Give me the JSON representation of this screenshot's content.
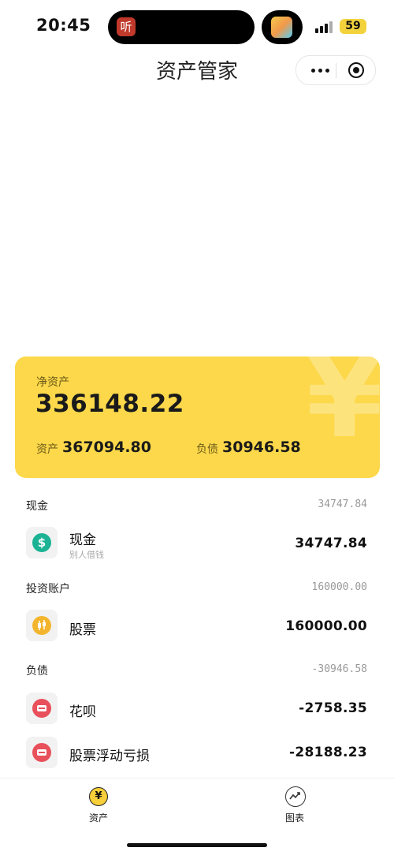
{
  "status_bar": {
    "time": "20:45",
    "battery": "59",
    "island_app_glyph": "听"
  },
  "nav": {
    "title": "资产管家"
  },
  "summary": {
    "net_assets_label": "净资产",
    "net_assets_value": "336148.22",
    "assets_label": "资产",
    "assets_value": "367094.80",
    "liabilities_label": "负债",
    "liabilities_value": "30946.58",
    "watermark": "¥"
  },
  "sections": [
    {
      "title": "现金",
      "total": "34747.84",
      "items": [
        {
          "name": "现金",
          "note": "别人借钱",
          "amount": "34747.84",
          "icon": "dollar-icon",
          "color": "#1cb394"
        }
      ]
    },
    {
      "title": "投资账户",
      "total": "160000.00",
      "items": [
        {
          "name": "股票",
          "amount": "160000.00",
          "icon": "candlestick-icon",
          "color": "#f3b52e"
        }
      ]
    },
    {
      "title": "负债",
      "total": "-30946.58",
      "items": [
        {
          "name": "花呗",
          "amount": "-2758.35",
          "icon": "card-icon",
          "color": "#e8505b"
        },
        {
          "name": "股票浮动亏损",
          "amount": "-28188.23",
          "icon": "card-icon",
          "color": "#e8505b"
        }
      ]
    }
  ],
  "tabs": [
    {
      "label": "资产",
      "icon": "yen-icon",
      "active": true
    },
    {
      "label": "图表",
      "icon": "trend-chart-icon",
      "active": false
    }
  ]
}
